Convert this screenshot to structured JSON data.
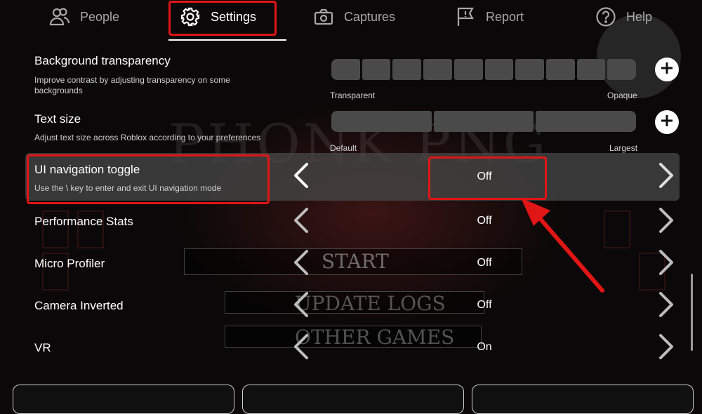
{
  "tabs": [
    {
      "label": "People",
      "icon": "people-icon"
    },
    {
      "label": "Settings",
      "icon": "gear-icon"
    },
    {
      "label": "Captures",
      "icon": "camera-icon"
    },
    {
      "label": "Report",
      "icon": "flag-icon"
    },
    {
      "label": "Help",
      "icon": "help-icon"
    }
  ],
  "active_tab": "Settings",
  "background": {
    "game_title": "PHONK PNG",
    "menu": [
      "START",
      "UPDATE LOGS",
      "OTHER GAMES"
    ]
  },
  "settings": {
    "background_transparency": {
      "title": "Background transparency",
      "description": "Improve contrast by adjusting transparency on some backgrounds",
      "min_label": "Transparent",
      "max_label": "Opaque",
      "segments": 10
    },
    "text_size": {
      "title": "Text size",
      "description": "Adjust text size across Roblox according to your preferences",
      "min_label": "Default",
      "max_label": "Largest",
      "segments": 3
    },
    "ui_navigation_toggle": {
      "title": "UI navigation toggle",
      "description": "Use the \\ key to enter and exit UI navigation mode",
      "value": "Off"
    },
    "performance_stats": {
      "title": "Performance Stats",
      "value": "Off"
    },
    "micro_profiler": {
      "title": "Micro Profiler",
      "value": "Off"
    },
    "camera_inverted": {
      "title": "Camera Inverted",
      "value": "Off"
    },
    "vr": {
      "title": "VR",
      "value": "On"
    }
  },
  "colors": {
    "highlight_red": "#e01515",
    "row_highlight": "#464646",
    "slider_segment": "#4a4a4a",
    "inactive_tab_text": "#a7a7a7"
  }
}
